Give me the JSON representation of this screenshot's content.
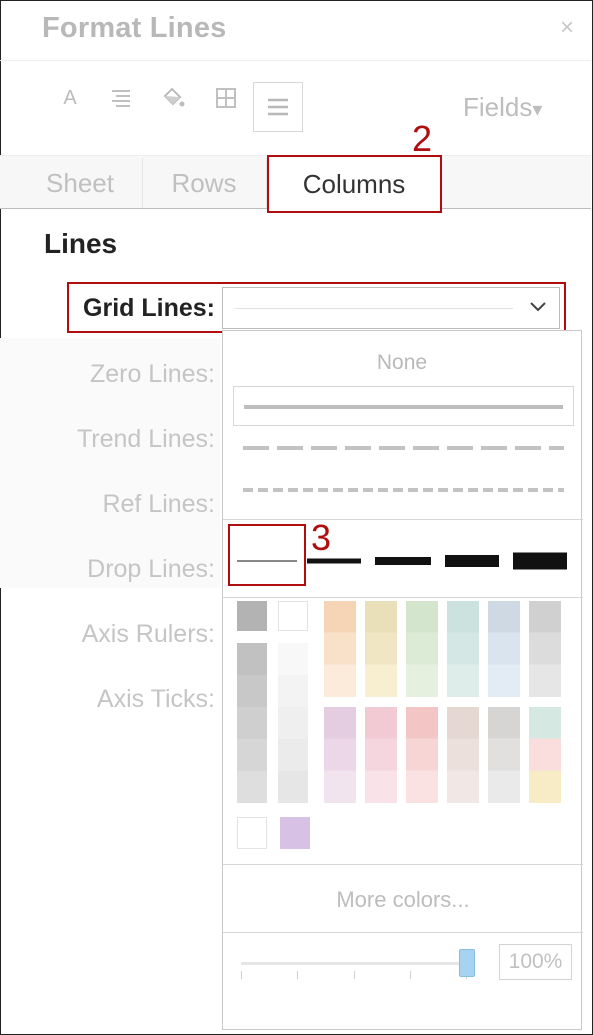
{
  "header": {
    "title": "Format Lines",
    "close": "×"
  },
  "toolbar": {
    "icons": [
      "font-icon",
      "alignment-icon",
      "shading-icon",
      "borders-icon",
      "lines-icon"
    ],
    "fields_label": "Fields",
    "fields_chevron": "▾"
  },
  "tabs": [
    {
      "label": "Sheet"
    },
    {
      "label": "Rows"
    },
    {
      "label": "Columns",
      "selected": true
    }
  ],
  "section": {
    "title": "Lines"
  },
  "rows": [
    {
      "label": "Grid Lines:"
    },
    {
      "label": "Zero Lines:"
    },
    {
      "label": "Trend Lines:"
    },
    {
      "label": "Ref Lines:"
    },
    {
      "label": "Drop Lines:"
    },
    {
      "label": "Axis Rulers:"
    },
    {
      "label": "Axis Ticks:"
    }
  ],
  "annotations": {
    "tab_step": "2",
    "weight_step": "3"
  },
  "dropdown": {
    "none_label": "None",
    "line_styles": [
      "solid",
      "dashed",
      "dotted"
    ],
    "line_weights": [
      1,
      2,
      3,
      4,
      5
    ],
    "gray_colors": [
      "#b3b3b3",
      "#ffffff",
      "#c4c4c4",
      "#f4f4f4",
      "#cacaca",
      "#f0f0f0",
      "#d1d1d1",
      "#eeeeee",
      "#d7d7d7",
      "#eaeaea",
      "#e0e0e0",
      "#e6e6e6"
    ],
    "palette_top": [
      [
        "#f6d5b6",
        "#f9e0c9",
        "#fceada"
      ],
      [
        "#e9dfb8",
        "#f0e6c3",
        "#f7efcf"
      ],
      [
        "#d3e5cd",
        "#dcebd6",
        "#e6f0df"
      ],
      [
        "#cbe2df",
        "#d5e7e5",
        "#dfedea"
      ],
      [
        "#cfd9e4",
        "#d9e4ee",
        "#e3ecf4"
      ],
      [
        "#d0d0d0",
        "#dcdcdc",
        "#e6e6e6"
      ]
    ],
    "palette_bottom": [
      [
        "#e4cce1",
        "#ebd7e8",
        "#f2e4ef"
      ],
      [
        "#f1cad4",
        "#f5d6de",
        "#f9e2e8"
      ],
      [
        "#f3c6c6",
        "#f7d5d5",
        "#fbe2e2"
      ],
      [
        "#e5d7d1",
        "#ebe0dc",
        "#f1e8e6"
      ],
      [
        "#d7d5d4",
        "#e1e0df",
        "#eaeaea"
      ],
      [
        "#d5e8e2",
        "#fadddd",
        "#f8ecc6"
      ]
    ],
    "recent_colors": [
      "#ffffff",
      "#d7c1e4"
    ],
    "more_colors": "More colors...",
    "opacity": "100%",
    "opacity_value": 1.0
  }
}
